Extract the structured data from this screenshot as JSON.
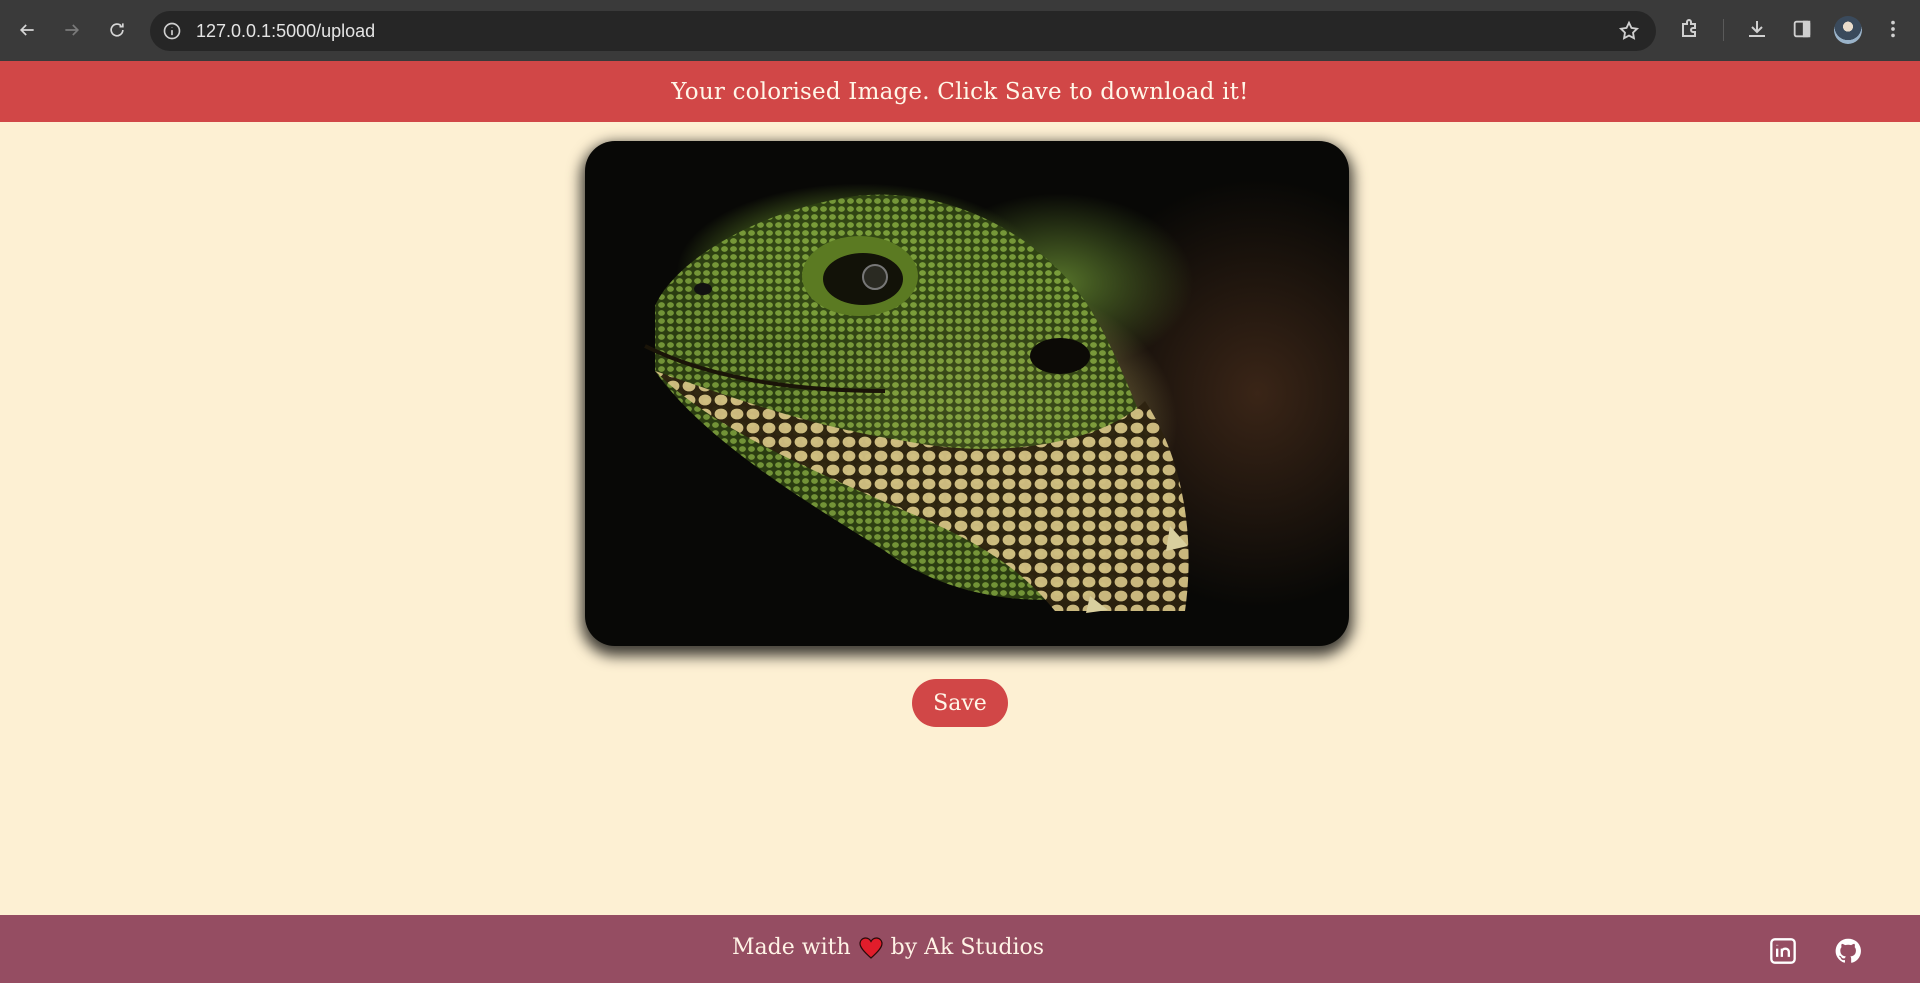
{
  "browser": {
    "url": "127.0.0.1:5000/upload",
    "icons": [
      "back-arrow-icon",
      "forward-arrow-icon",
      "reload-icon",
      "info-icon",
      "star-icon",
      "extensions-icon",
      "download-icon",
      "side-panel-icon",
      "profile-avatar",
      "more-menu-icon"
    ]
  },
  "banner": {
    "text": "Your colorised Image. Click Save to download it!"
  },
  "image": {
    "subject": "colorised-lizard-image"
  },
  "actions": {
    "save_label": "Save"
  },
  "footer": {
    "text_before": "Made with",
    "text_after": "by Ak Studios",
    "icons": [
      "heart-icon",
      "linkedin-icon",
      "github-icon"
    ]
  },
  "colors": {
    "banner": "#d14747",
    "page_background": "#fdf0d3",
    "button": "#d14747",
    "footer": "#954d62"
  }
}
